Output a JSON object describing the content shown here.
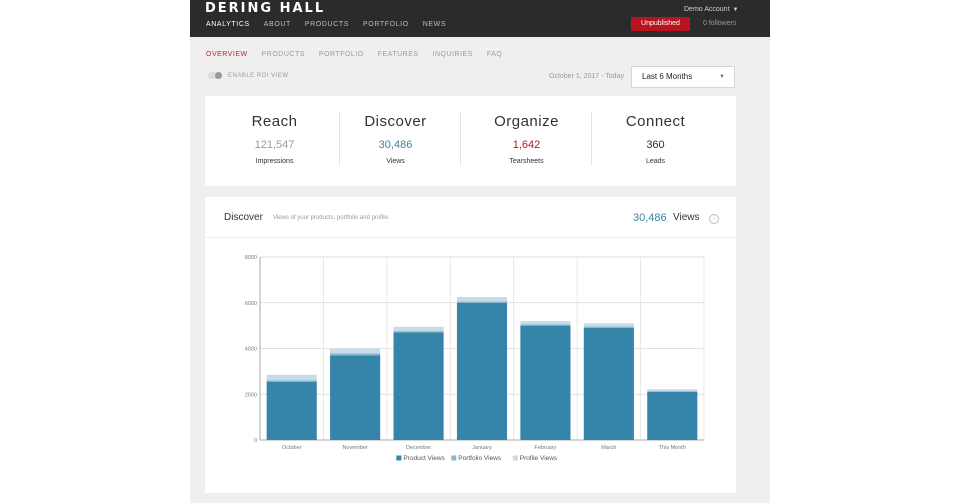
{
  "topbar": {
    "brand": "DERING HALL",
    "nav": [
      "ANALYTICS",
      "ABOUT",
      "PRODUCTS",
      "PORTFOLIO",
      "NEWS"
    ],
    "account": "Demo Account",
    "status": "Unpublished",
    "followers": "0 followers"
  },
  "subnav": [
    "OVERVIEW",
    "PRODUCTS",
    "PORTFOLIO",
    "FEATURES",
    "INQUIRIES",
    "FAQ"
  ],
  "roi_label": "ENABLE ROI VIEW",
  "date_range": "October 1, 2017 - Today",
  "period": "Last 6 Months",
  "metrics": [
    {
      "title": "Reach",
      "value": "121,547",
      "unit": "Impressions",
      "color": "#9a9a9a"
    },
    {
      "title": "Discover",
      "value": "30,486",
      "unit": "Views",
      "color": "#3a86a8"
    },
    {
      "title": "Organize",
      "value": "1,642",
      "unit": "Tearsheets",
      "color": "#b8141f"
    },
    {
      "title": "Connect",
      "value": "360",
      "unit": "Leads",
      "color": "#333333"
    }
  ],
  "discover": {
    "title": "Discover",
    "subtitle": "Views of your products, portfolio and profile.",
    "count": "30,486",
    "unit": "Views",
    "info_glyph": "i"
  },
  "colors": {
    "product": "#3584a9",
    "portfolio": "#8ab6cf",
    "profile": "#c6dce8",
    "accent_red": "#b8141f"
  },
  "chart_data": {
    "type": "bar",
    "stacked": true,
    "categories": [
      "October",
      "November",
      "December",
      "January",
      "February",
      "March",
      "This Month"
    ],
    "series": [
      {
        "name": "Product Views",
        "values": [
          2550,
          3700,
          4700,
          6000,
          5000,
          4900,
          2100
        ]
      },
      {
        "name": "Portfolio Views",
        "values": [
          60,
          80,
          60,
          60,
          60,
          60,
          40
        ]
      },
      {
        "name": "Profile Views",
        "values": [
          240,
          220,
          190,
          190,
          140,
          140,
          80
        ]
      }
    ],
    "y_ticks": [
      "0",
      "2000",
      "4000",
      "6000",
      "8000"
    ],
    "ylim": [
      0,
      8000
    ],
    "grid": true,
    "legend": "bottom"
  }
}
